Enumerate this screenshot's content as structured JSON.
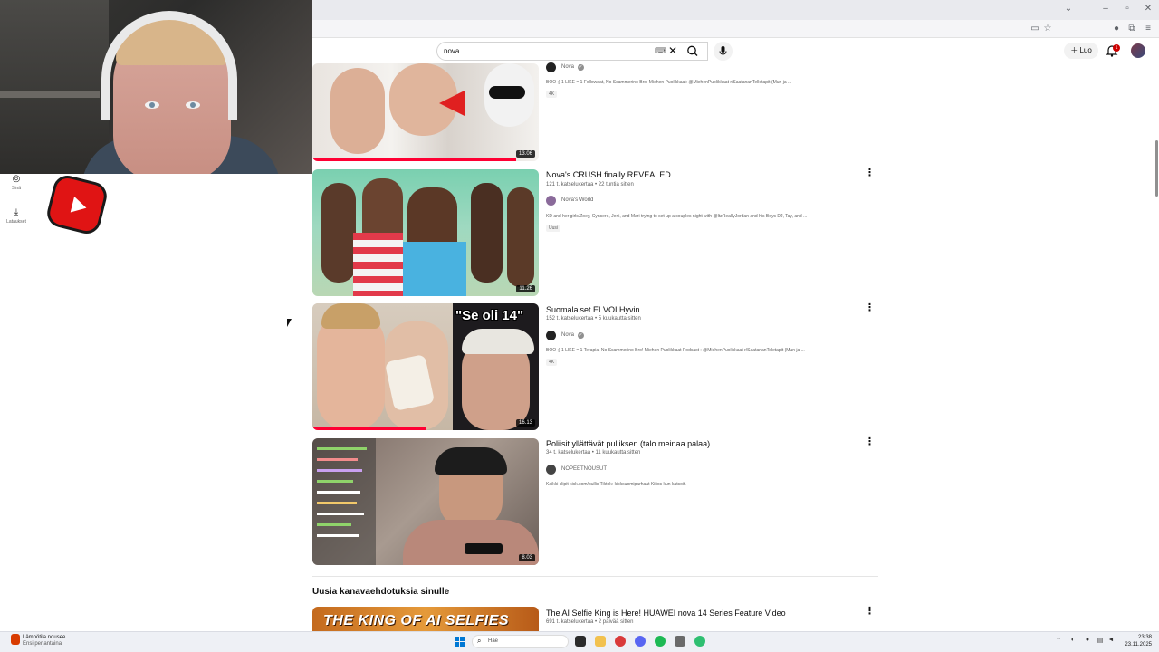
{
  "search": {
    "query": "nova"
  },
  "header": {
    "create_label": "Luo",
    "notification_count": "1"
  },
  "left_nav": {
    "items": [
      {
        "label": "Sinä",
        "icon": "user-circle-icon"
      },
      {
        "label": "Lataukset",
        "icon": "download-icon"
      }
    ]
  },
  "results": [
    {
      "title": "",
      "meta": "",
      "channel": "Nova",
      "verified": true,
      "description": "BÖÖ ;) 1 LIKE = 1 Followaat, No Scammerino Bro! Miehen Puolikkaat: @MiehenPuolikkaat r/SaatananTelletapit (Mun ja ...",
      "badge": "4K",
      "duration": "13.06",
      "progress": 0.9
    },
    {
      "title": "Nova's CRUSH finally REVEALED",
      "meta": "121 t. katselukertaa • 22 tuntia sitten",
      "channel": "Nova's World",
      "verified": false,
      "description": "KD and her girls Zoey, Cyncere, Jeni, and Mari trying to set up a couples night with @ItzReallyJordan and his Boys DJ, Tay, and ...",
      "badge": "Uusi",
      "duration": "11.26",
      "progress": 0
    },
    {
      "title": "Suomalaiset EI VOI Hyvin...",
      "meta": "152 t. katselukertaa • 5 kuukautta sitten",
      "channel": "Nova",
      "verified": true,
      "description": "BÖÖ ;) 1 LIKE = 1 Terapia, No Scammerino Bro! Miehen Puolikkaat Podcast : @MiehenPuolikkaat r/SaatananTeletapit (Mun ja ...",
      "badge": "4K",
      "duration": "16.13",
      "progress": 0.5
    },
    {
      "title": "Poliisit yllättävät pulliksen (talo meinaa palaa)",
      "meta": "34 t. katselukertaa • 11 kuukautta sitten",
      "channel": "NOPEETNOUSUT",
      "verified": false,
      "description": "Kaikki clipit kick.com/pullis Tiktok: kicksuomiparhaat Kiitos kun katsoit.",
      "badge": "",
      "duration": "8.03",
      "progress": 0
    }
  ],
  "section": {
    "title": "Uusia kanavaehdotuksia sinulle",
    "item": {
      "title": "The AI Selfie King is Here! HUAWEI nova 14 Series Feature Video",
      "meta": "691 t. katselukertaa • 2 päivää sitten",
      "thumb_text": "THE KING OF AI SELFIES"
    }
  },
  "thumb_texts": {
    "se_oli": "\"Se oli 14\""
  },
  "taskbar": {
    "weather_title": "Lämpötila nousee",
    "weather_sub": "Ensi perjantaina",
    "search_placeholder": "Hae",
    "time": "23.38",
    "date": "23.11.2025"
  }
}
